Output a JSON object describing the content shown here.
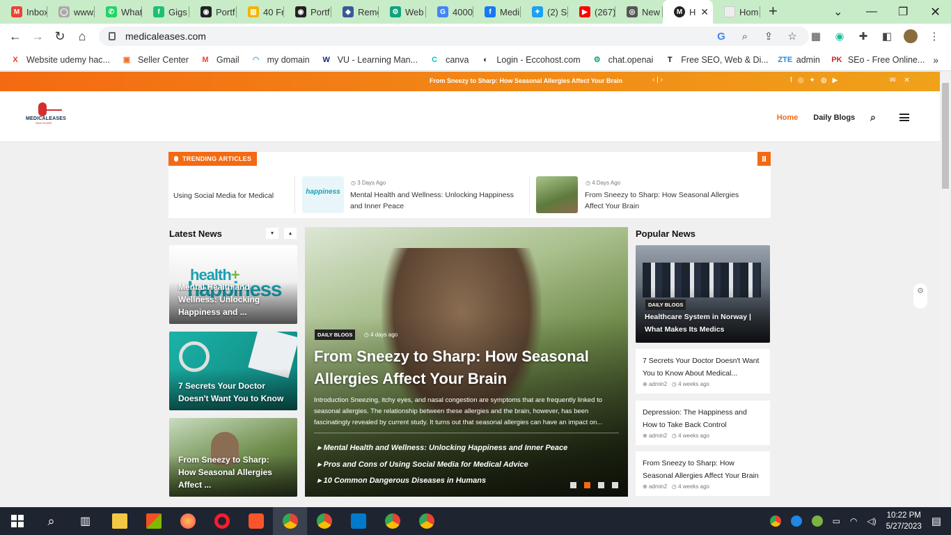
{
  "browser": {
    "tabs": [
      {
        "label": "Inbox",
        "color": "#ea4335",
        "glyph": "M"
      },
      {
        "label": "www.",
        "color": "#aaaaaa",
        "glyph": "◯"
      },
      {
        "label": "What",
        "color": "#25d366",
        "glyph": "✆"
      },
      {
        "label": "Gigs",
        "color": "#1dbf73",
        "glyph": "f"
      },
      {
        "label": "Portf",
        "color": "#222222",
        "glyph": "◉"
      },
      {
        "label": "40 Fr",
        "color": "#f4b400",
        "glyph": "▥"
      },
      {
        "label": "Portf",
        "color": "#222222",
        "glyph": "◉"
      },
      {
        "label": "Remo",
        "color": "#3b5998",
        "glyph": "◆"
      },
      {
        "label": "Web",
        "color": "#10a37f",
        "glyph": "⚙"
      },
      {
        "label": "4000",
        "color": "#4285f4",
        "glyph": "G"
      },
      {
        "label": "Medi",
        "color": "#1877f2",
        "glyph": "f"
      },
      {
        "label": "(2) Se",
        "color": "#1da1f2",
        "glyph": "✦"
      },
      {
        "label": "(267)",
        "color": "#ff0000",
        "glyph": "▶"
      },
      {
        "label": "New",
        "color": "#555555",
        "glyph": "◎"
      }
    ],
    "active_tab": {
      "label": "H",
      "glyph": "M"
    },
    "last_tab": {
      "label": "Hom"
    },
    "new_tab": "+",
    "url": "medicaleases.com",
    "bookmarks": [
      {
        "label": "Website udemy hac...",
        "glyph": "X",
        "color": "#e53935"
      },
      {
        "label": "Seller Center",
        "glyph": "▣",
        "color": "#f57224"
      },
      {
        "label": "Gmail",
        "glyph": "M",
        "color": "#ea4335"
      },
      {
        "label": "my domain",
        "glyph": "◠",
        "color": "#29b6f6"
      },
      {
        "label": "VU - Learning Man...",
        "glyph": "W",
        "color": "#1a237e"
      },
      {
        "label": "canva",
        "glyph": "C",
        "color": "#00c4cc"
      },
      {
        "label": "Login - Eccohost.com",
        "glyph": "◐",
        "color": "#222222"
      },
      {
        "label": "chat.openai",
        "glyph": "⚙",
        "color": "#10a37f"
      },
      {
        "label": "Free SEO, Web & Di...",
        "glyph": "T",
        "color": "#111111"
      },
      {
        "label": "admin",
        "glyph": "ZTE",
        "color": "#1e88e5"
      },
      {
        "label": "SEo - Free Online...",
        "glyph": "PK",
        "color": "#c62828"
      }
    ],
    "more_bookmarks": "»"
  },
  "site": {
    "ticker": "From Sneezy to Sharp: How Seasonal Allergies Affect Your Brain",
    "ticker_arrows": "‹  |  ›",
    "logo_text": "MEDICALEASES",
    "logo_sub": "HEALTHCARE",
    "nav": {
      "home": "Home",
      "blogs": "Daily Blogs"
    },
    "trending": {
      "badge": "TRENDING ARTICLES",
      "items": [
        {
          "title": "Using Social Media for Medical"
        },
        {
          "title": "Mental Health and Wellness: Unlocking Happiness and Inner Peace",
          "time": "3 Days Ago"
        },
        {
          "title": "From Sneezy to Sharp: How Seasonal Allergies Affect Your Brain",
          "time": "4 Days Ago"
        }
      ]
    },
    "latest": {
      "title": "Latest News",
      "cards": [
        {
          "title": "Mental Health and Wellness: Unlocking Happiness and ...",
          "img_text": "health+ happiness"
        },
        {
          "title": "7 Secrets Your Doctor Doesn't Want You to Know"
        },
        {
          "title": "From Sneezy to Sharp: How Seasonal Allergies Affect ..."
        }
      ]
    },
    "hero": {
      "category": "DAILY BLOGS",
      "time": "4 days ago",
      "title": "From Sneezy to Sharp: How Seasonal Allergies Affect Your Brain",
      "excerpt": "Introduction Sneezing, itchy eyes, and nasal congestion are symptoms that are frequently linked to seasonal allergies. The relationship between these allergies and the brain, however, has been fascinatingly revealed by current study. It turns out that seasonal allergies can have an impact on...",
      "links": [
        "Mental Health and Wellness: Unlocking Happiness and Inner Peace",
        "Pros and Cons of Using Social Media for Medical Advice",
        "10 Common Dangerous Diseases in Humans"
      ]
    },
    "popular": {
      "title": "Popular News",
      "feature": {
        "category": "DAILY BLOGS",
        "title": "Healthcare System in Norway | What Makes Its Medics"
      },
      "items": [
        {
          "title": "7 Secrets Your Doctor Doesn't Want You to Know About Medical...",
          "author": "admin2",
          "time": "4 weeks ago"
        },
        {
          "title": "Depression: The Happiness and How to Take Back Control",
          "author": "admin2",
          "time": "4 weeks ago"
        },
        {
          "title": "From Sneezy to Sharp: How Seasonal Allergies Affect Your Brain",
          "author": "admin2",
          "time": "4 weeks ago"
        }
      ]
    }
  },
  "taskbar": {
    "time": "10:22 PM",
    "date": "5/27/2023"
  }
}
